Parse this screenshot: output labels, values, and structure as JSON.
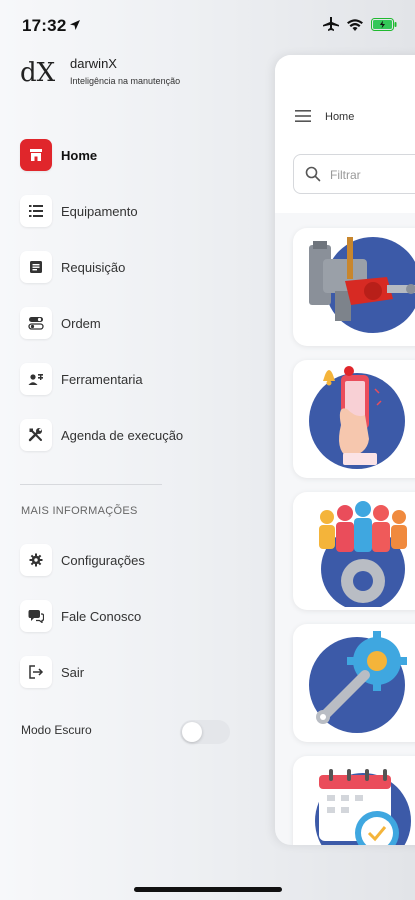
{
  "status": {
    "time": "17:32"
  },
  "brand": {
    "logo": "dX",
    "name": "darwinX",
    "tagline": "Inteligência na manutenção"
  },
  "menu": [
    {
      "label": "Home",
      "icon": "home-icon",
      "active": true
    },
    {
      "label": "Equipamento",
      "icon": "list-icon"
    },
    {
      "label": "Requisição",
      "icon": "document-icon"
    },
    {
      "label": "Ordem",
      "icon": "toggle-list-icon"
    },
    {
      "label": "Ferramentaria",
      "icon": "user-tools-icon"
    },
    {
      "label": "Agenda de execução",
      "icon": "tools-icon"
    }
  ],
  "section_title": "MAIS INFORMAÇÕES",
  "more": [
    {
      "label": "Configurações",
      "icon": "gear-icon"
    },
    {
      "label": "Fale Conosco",
      "icon": "chat-icon"
    },
    {
      "label": "Sair",
      "icon": "logout-icon"
    }
  ],
  "dark_mode": {
    "label": "Modo Escuro",
    "enabled": false
  },
  "main": {
    "breadcrumb": "Home",
    "search": {
      "placeholder": "Filtrar",
      "value": ""
    },
    "cards": [
      "engine-illustration",
      "phone-alert-illustration",
      "team-gear-illustration",
      "wrench-gear-illustration",
      "calendar-clock-illustration"
    ]
  },
  "colors": {
    "accent": "#e0262b",
    "illustration_blue": "#3c5aa8"
  }
}
